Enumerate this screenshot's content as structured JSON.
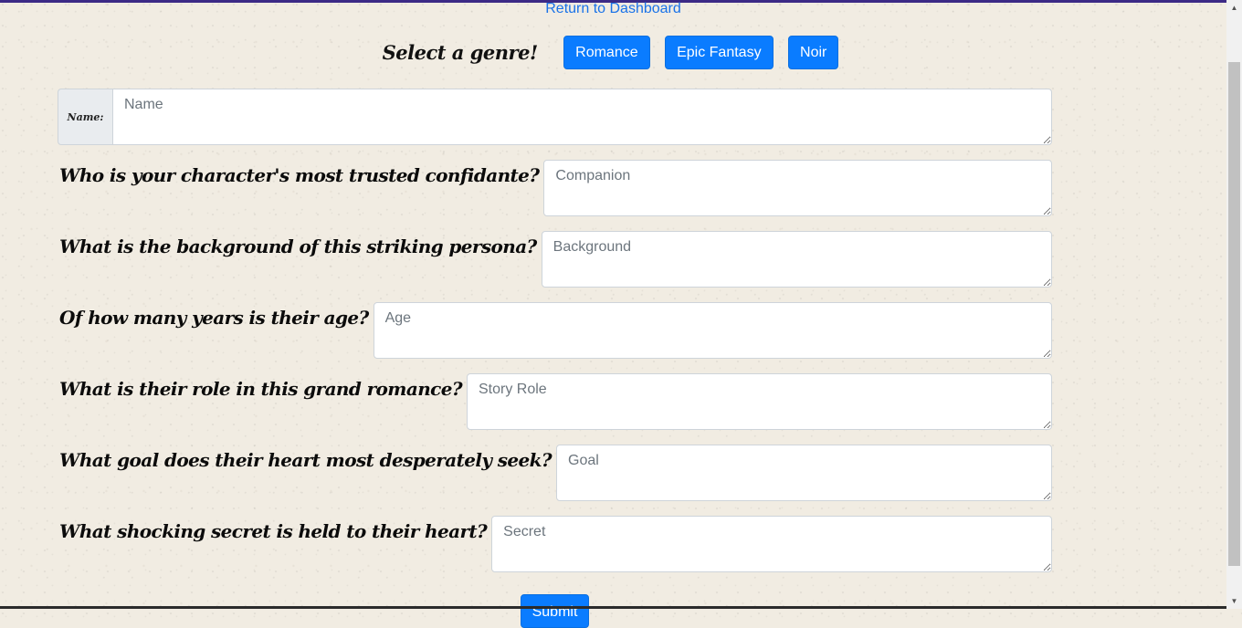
{
  "nav": {
    "return_link": "Return to Dashboard"
  },
  "genre": {
    "label": "Select a genre!",
    "buttons": [
      "Romance",
      "Epic Fantasy",
      "Noir"
    ]
  },
  "form": {
    "name": {
      "addon": "Name:",
      "placeholder": "Name"
    },
    "questions": [
      {
        "label": "Who is your character's most trusted confidante?",
        "placeholder": "Companion"
      },
      {
        "label": "What is the background of this striking persona?",
        "placeholder": "Background"
      },
      {
        "label": "Of how many years is their age?",
        "placeholder": "Age"
      },
      {
        "label": "What is their role in this grand romance?",
        "placeholder": "Story Role"
      },
      {
        "label": "What goal does their heart most desperately seek?",
        "placeholder": "Goal"
      },
      {
        "label": "What shocking secret is held to their heart?",
        "placeholder": "Secret"
      }
    ],
    "submit_label": "Submit"
  },
  "colors": {
    "primary": "#0a7cff",
    "link": "#1a73e8",
    "paper": "#f1ece2"
  }
}
